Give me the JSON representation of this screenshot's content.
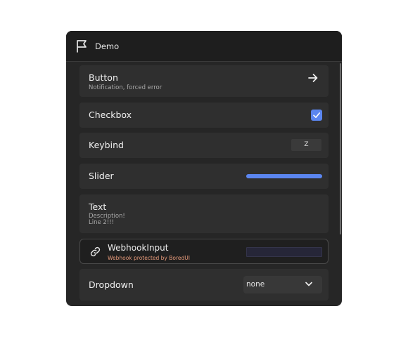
{
  "window": {
    "title": "Demo",
    "title_icon": "flag-icon"
  },
  "items": {
    "button": {
      "label": "Button",
      "description": "Notification, forced error",
      "icon": "arrow-right-icon"
    },
    "checkbox": {
      "label": "Checkbox",
      "checked": true
    },
    "keybind": {
      "label": "Keybind",
      "key": "Z"
    },
    "slider": {
      "label": "Slider",
      "value_fraction": 1.0
    },
    "text": {
      "label": "Text",
      "description_line1": "Description!",
      "description_line2": "Line 2!!!"
    },
    "webhook": {
      "label": "WebhookInput",
      "description": "Webhook protected by BoredUI",
      "icon": "link-icon",
      "value": ""
    },
    "dropdown": {
      "label": "Dropdown",
      "selected": "none",
      "icon": "chevron-down-icon"
    }
  },
  "colors": {
    "accent": "#5b86f0",
    "webhook_note": "#e79a7a",
    "panel": "#262626",
    "card": "#2f2f2f"
  }
}
